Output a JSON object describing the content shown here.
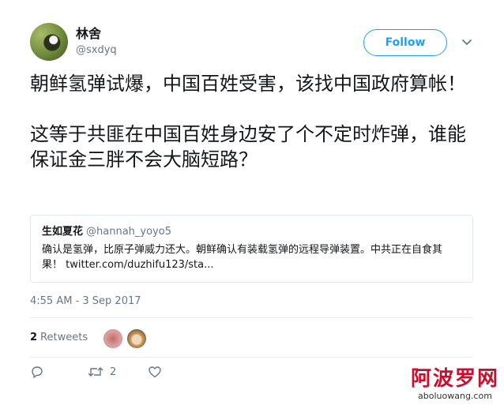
{
  "author": {
    "name": "林舍",
    "handle": "@sxdyq"
  },
  "follow_label": "Follow",
  "tweet": {
    "paragraphs": [
      "朝鲜氢弹试爆，中国百姓受害，该找中国政府算帐！",
      "这等于共匪在中国百姓身边安了个不定时炸弹，谁能保证金三胖不会大脑短路？"
    ]
  },
  "quote": {
    "name": "生如夏花",
    "handle": "@hannah_yoyo5",
    "text": "确认是氢弹，比原子弹威力还大。朝鲜确认有装载氢弹的远程导弹装置。中共正在自食其果！ twitter.com/duzhifu123/sta..."
  },
  "timestamp": "4:55 AM - 3 Sep 2017",
  "stats": {
    "retweets_count": "2",
    "retweets_label": "Retweets"
  },
  "actions": {
    "retweet_count": "2"
  },
  "watermark": {
    "big": "阿波罗网",
    "small": "aboluowang.com"
  },
  "colors": {
    "accent": "#1da1f2",
    "muted": "#657786",
    "watermark": "#c8102e"
  }
}
